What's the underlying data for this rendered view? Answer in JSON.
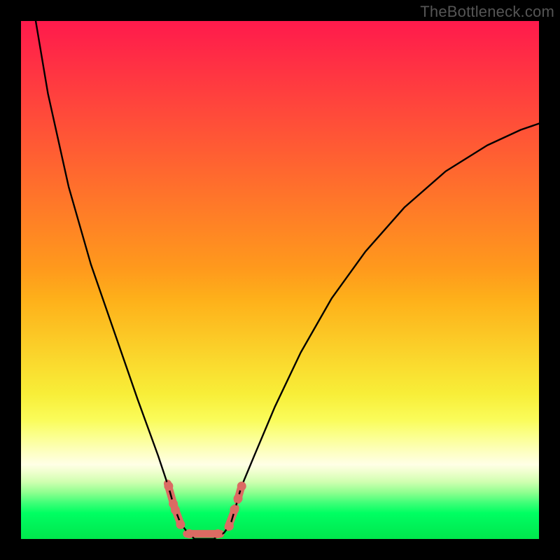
{
  "watermark": "TheBottleneck.com",
  "chart_data": {
    "type": "line",
    "title": "",
    "xlabel": "",
    "ylabel": "",
    "description": "Bottleneck curve on a red-yellow-green vertical gradient. The black line reaches a minimum near x=0.35 (green zone) with salmon-colored marker overlays at and around the minimum.",
    "xlim": [
      0,
      1
    ],
    "ylim": [
      0,
      1
    ],
    "curve": {
      "x": [
        0.0,
        0.02,
        0.052,
        0.092,
        0.135,
        0.18,
        0.225,
        0.265,
        0.285,
        0.295,
        0.308,
        0.322,
        0.335,
        0.372,
        0.392,
        0.405,
        0.415,
        0.425,
        0.45,
        0.49,
        0.54,
        0.6,
        0.665,
        0.74,
        0.82,
        0.9,
        0.965,
        1.0
      ],
      "y": [
        1.186,
        1.05,
        0.86,
        0.68,
        0.53,
        0.4,
        0.27,
        0.16,
        0.1,
        0.064,
        0.03,
        0.012,
        0.0,
        0.0,
        0.012,
        0.03,
        0.064,
        0.1,
        0.16,
        0.255,
        0.36,
        0.465,
        0.555,
        0.64,
        0.71,
        0.76,
        0.79,
        0.802
      ]
    },
    "highlight_segments": [
      {
        "x0": 0.283,
        "y0": 0.107,
        "x1": 0.294,
        "y1": 0.069
      },
      {
        "x0": 0.296,
        "y0": 0.062,
        "x1": 0.309,
        "y1": 0.027
      },
      {
        "x0": 0.32,
        "y0": 0.01,
        "x1": 0.385,
        "y1": 0.01
      },
      {
        "x0": 0.4,
        "y0": 0.023,
        "x1": 0.414,
        "y1": 0.06
      },
      {
        "x0": 0.418,
        "y0": 0.075,
        "x1": 0.426,
        "y1": 0.103
      }
    ],
    "highlight_dots": [
      {
        "x": 0.285,
        "y": 0.102
      },
      {
        "x": 0.294,
        "y": 0.068
      },
      {
        "x": 0.298,
        "y": 0.056
      },
      {
        "x": 0.308,
        "y": 0.028
      },
      {
        "x": 0.325,
        "y": 0.01
      },
      {
        "x": 0.38,
        "y": 0.01
      },
      {
        "x": 0.402,
        "y": 0.025
      },
      {
        "x": 0.412,
        "y": 0.057
      },
      {
        "x": 0.419,
        "y": 0.078
      },
      {
        "x": 0.426,
        "y": 0.102
      }
    ],
    "gradient_stops": [
      {
        "pos": 0.0,
        "color": "#ff1a4c"
      },
      {
        "pos": 0.5,
        "color": "#ff9a1c"
      },
      {
        "pos": 0.78,
        "color": "#fafc5a"
      },
      {
        "pos": 0.86,
        "color": "#ffffe6"
      },
      {
        "pos": 1.0,
        "color": "#00e84c"
      }
    ]
  }
}
